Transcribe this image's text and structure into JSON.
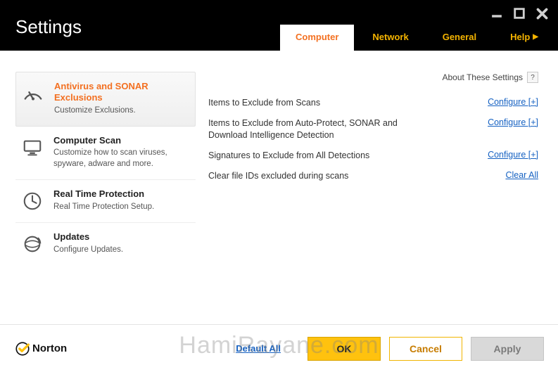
{
  "window": {
    "title": "Settings"
  },
  "tabs": {
    "computer": "Computer",
    "network": "Network",
    "general": "General",
    "help": "Help"
  },
  "sidebar": {
    "items": [
      {
        "title": "Antivirus and SONAR Exclusions",
        "desc": "Customize Exclusions."
      },
      {
        "title": "Computer Scan",
        "desc": "Customize how to scan viruses, spyware, adware and more."
      },
      {
        "title": "Real Time Protection",
        "desc": "Real Time Protection Setup."
      },
      {
        "title": "Updates",
        "desc": "Configure Updates."
      }
    ]
  },
  "content": {
    "about_label": "About These Settings",
    "rows": [
      {
        "label": "Items to Exclude from Scans",
        "action": "Configure [+]"
      },
      {
        "label": "Items to Exclude from Auto-Protect, SONAR and Download Intelligence Detection",
        "action": "Configure [+]"
      },
      {
        "label": "Signatures to Exclude from All Detections",
        "action": "Configure [+]"
      },
      {
        "label": "Clear file IDs excluded during scans",
        "action": "Clear All"
      }
    ]
  },
  "footer": {
    "brand": "Norton",
    "default_all": "Default All",
    "ok": "OK",
    "cancel": "Cancel",
    "apply": "Apply"
  },
  "watermark": "HamiRayane.com",
  "colors": {
    "accent_orange": "#f37021",
    "accent_yellow": "#ffc20e",
    "tab_yellow": "#f5b400",
    "link_blue": "#1561c2"
  }
}
